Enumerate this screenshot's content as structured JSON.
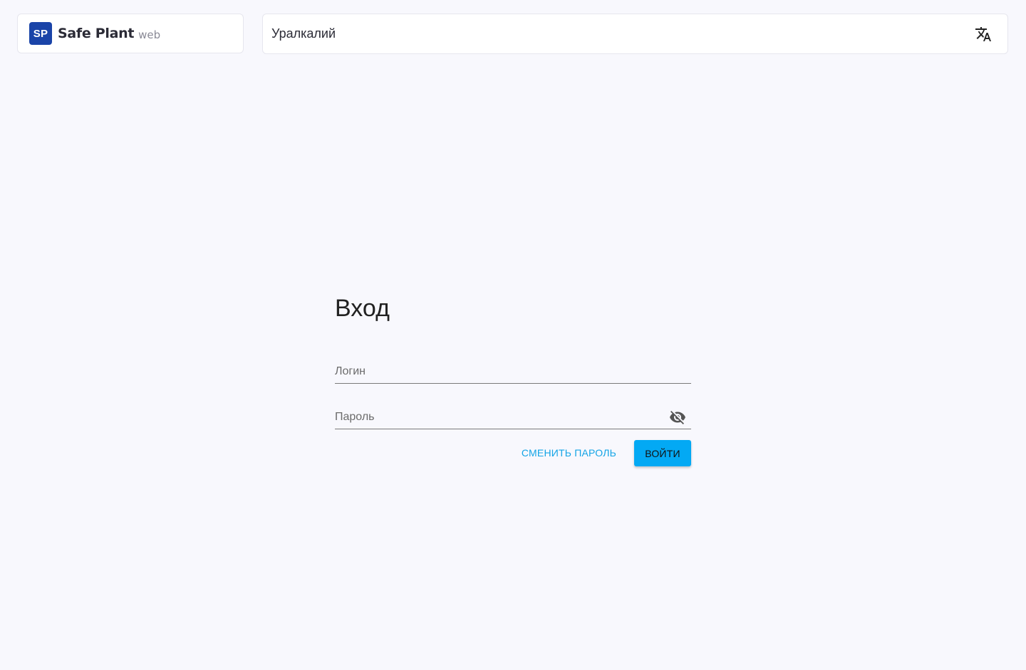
{
  "header": {
    "logo_badge": "SP",
    "logo_name": "Safe Plant",
    "logo_sub": "web",
    "organization": "Уралкалий",
    "translate_icon": "translate-icon"
  },
  "login": {
    "title": "Вход",
    "login_placeholder": "Логин",
    "password_placeholder": "Пароль",
    "visibility_icon": "eye-off-icon",
    "change_password_label": "СМЕНИТЬ ПАРОЛЬ",
    "submit_label": "ВОЙТИ"
  },
  "colors": {
    "background": "#f8f8fd",
    "logo_badge": "#1a44a8",
    "accent": "#03a9f4",
    "link": "#13a4e6"
  }
}
